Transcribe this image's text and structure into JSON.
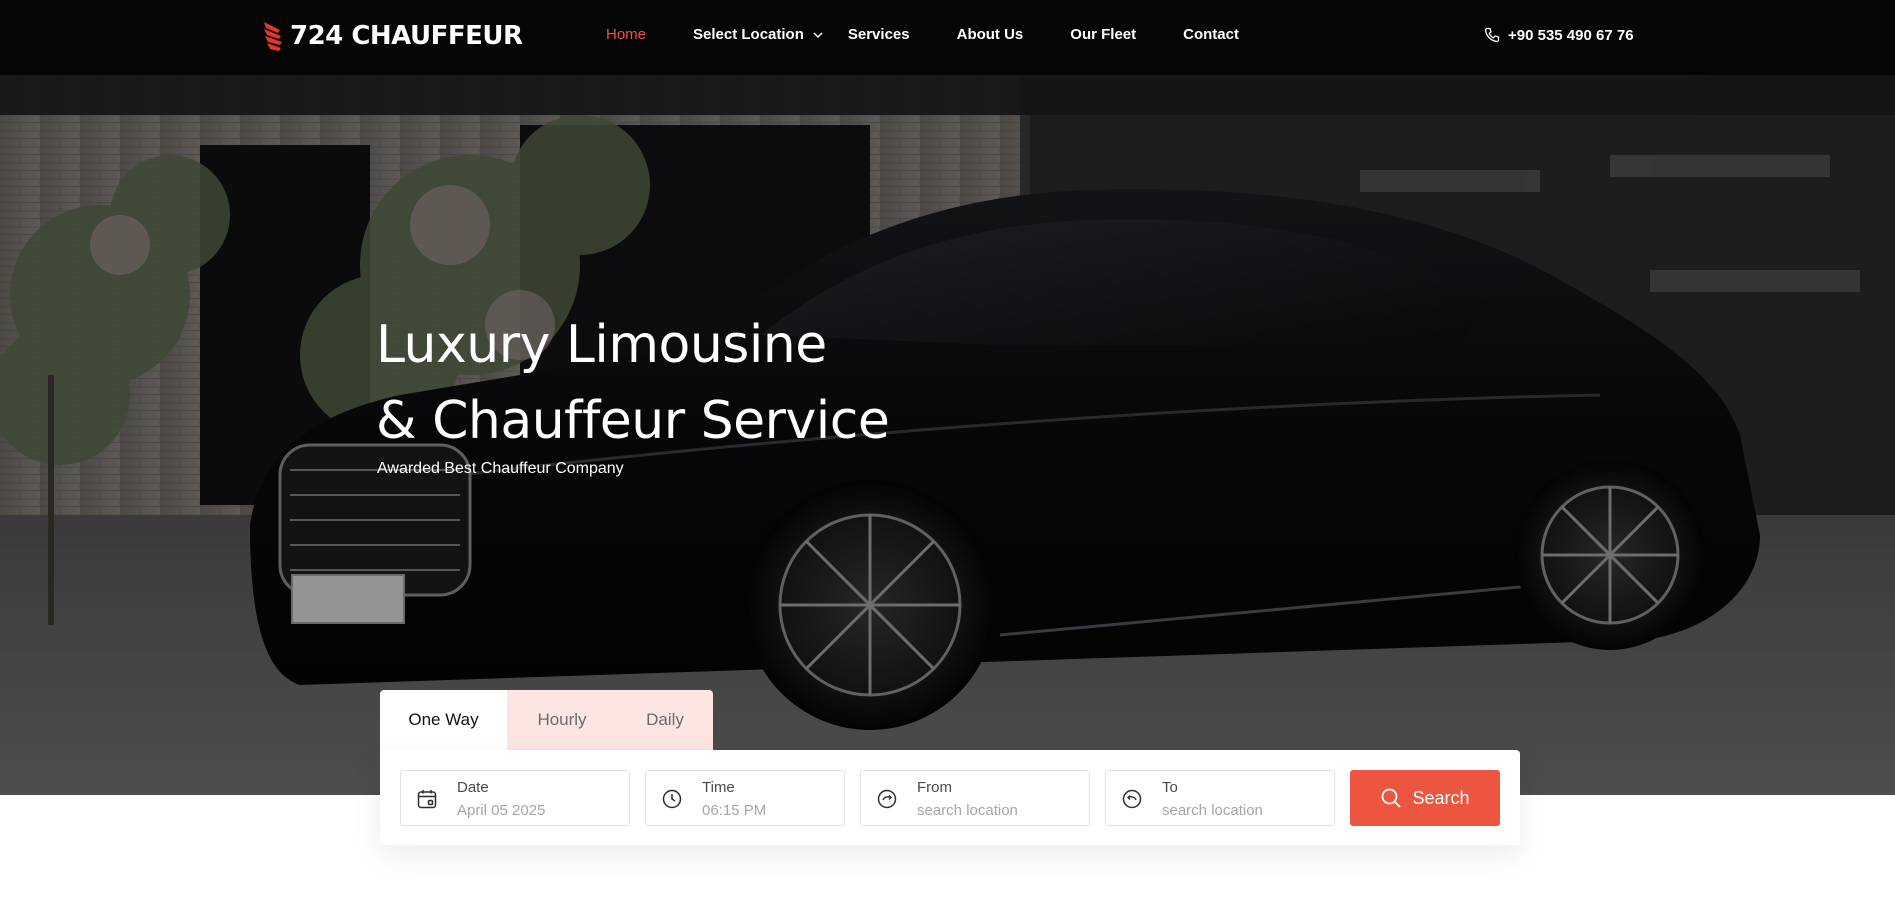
{
  "brand": {
    "name": "724 CHAUFFEUR",
    "accent_color": "#ec5640",
    "logo_icon": "red-wing-mark-icon"
  },
  "nav": {
    "items": [
      {
        "label": "Home",
        "active": true
      },
      {
        "label": "Select Location",
        "has_dropdown": true
      },
      {
        "label": "Services"
      },
      {
        "label": "About Us"
      },
      {
        "label": "Our Fleet"
      },
      {
        "label": "Contact"
      }
    ],
    "phone": "+90 535 490 67 76",
    "phone_icon": "phone-icon"
  },
  "hero": {
    "title_line1": "Luxury Limousine",
    "title_line2": "& Chauffeur Service",
    "subtitle": "Awarded Best Chauffeur Company",
    "background": "black-luxury-sedan-photo"
  },
  "booking": {
    "tabs": [
      {
        "label": "One Way",
        "active": true
      },
      {
        "label": "Hourly"
      },
      {
        "label": "Daily"
      }
    ],
    "fields": {
      "date": {
        "label": "Date",
        "value": "April 05 2025",
        "icon": "calendar-icon"
      },
      "time": {
        "label": "Time",
        "value": "06:15 PM",
        "icon": "clock-icon"
      },
      "from": {
        "label": "From",
        "placeholder": "search location",
        "icon": "location-pin-icon"
      },
      "to": {
        "label": "To",
        "placeholder": "search location",
        "icon": "location-pin-icon"
      }
    },
    "search_label": "Search",
    "search_icon": "search-icon"
  }
}
